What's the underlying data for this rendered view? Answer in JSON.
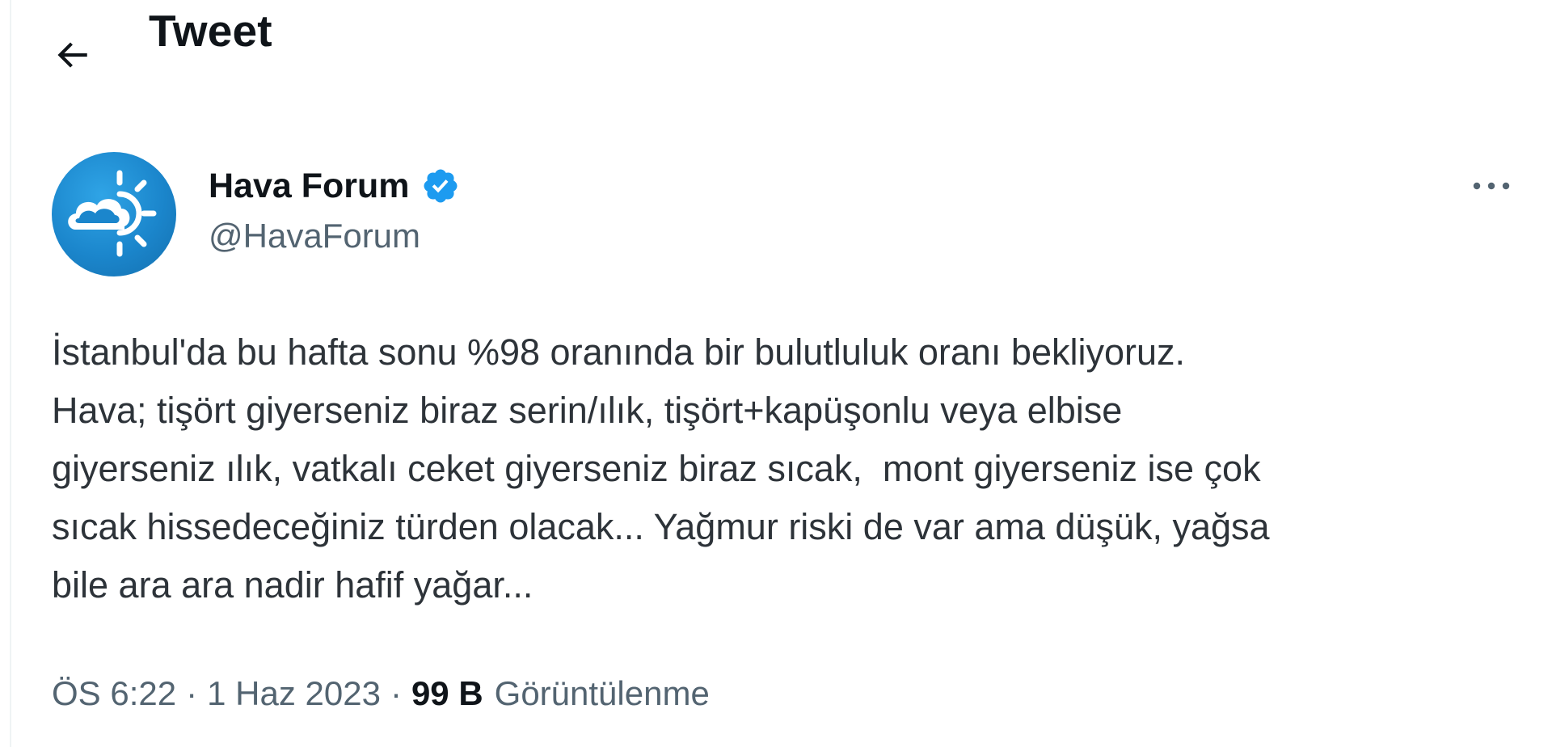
{
  "header": {
    "title": "Tweet",
    "back_icon": "arrow-left-icon"
  },
  "author": {
    "name": "Hava Forum",
    "handle": "@HavaForum",
    "verified": true,
    "verified_icon": "verified-badge-icon",
    "avatar_icon": "cloud-sun-logo",
    "avatar_color": "#1b86cc"
  },
  "more_icon": "more-dots-icon",
  "tweet": {
    "lines": [
      "İstanbul'da bu hafta sonu %98 oranında bir bulutluluk oranı bekliyoruz.",
      "Hava; tişört giyerseniz biraz serin/ılık, tişört+kapüşonlu veya elbise",
      "giyerseniz ılık, vatkalı ceket giyerseniz biraz sıcak,  mont giyerseniz ise çok",
      "sıcak hissedeceğiniz türden olacak... Yağmur riski de var ama düşük, yağsa",
      "bile ara ara nadir hafif yağar..."
    ]
  },
  "meta": {
    "time": "ÖS 6:22",
    "separator": "·",
    "date": "1 Haz 2023",
    "views_count": "99 B",
    "views_label": "Görüntülenme"
  },
  "colors": {
    "text_primary": "#0f1419",
    "text_secondary": "#536471",
    "verified_blue": "#1d9bf0",
    "border": "#eff3f4"
  }
}
